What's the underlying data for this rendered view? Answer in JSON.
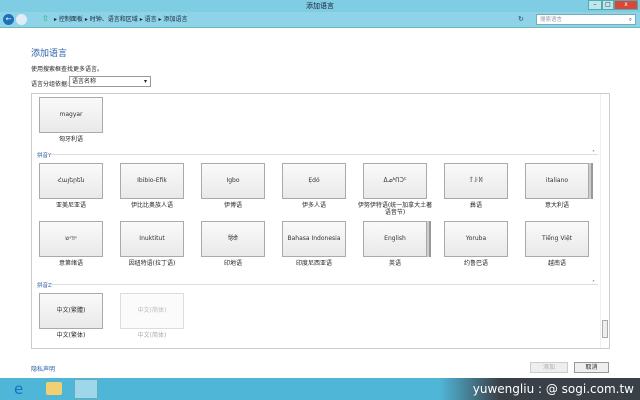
{
  "window": {
    "title": "添加语言",
    "min": "–",
    "max": "□",
    "close": "x"
  },
  "address": {
    "breadcrumb": [
      "控制面板",
      "时钟、语言和区域",
      "语言",
      "添加语言"
    ],
    "search_placeholder": "搜索语言"
  },
  "main": {
    "heading": "添加语言",
    "hint": "使用搜索框查找更多语言。",
    "group_label": "语言分组依据:",
    "group_value": "语言名称"
  },
  "top_tile": {
    "native": "magyar",
    "label": "匈牙利语"
  },
  "groups": [
    {
      "header": "拼音Y",
      "tiles": [
        {
          "native": "Հայերեն",
          "label": "亚美尼亚语"
        },
        {
          "native": "Ibibio-Efik",
          "label": "伊比比奥族人语"
        },
        {
          "native": "Igbo",
          "label": "伊博语"
        },
        {
          "native": "Ẹdó",
          "label": "伊多人语"
        },
        {
          "native": "ᐃᓄᒃᑎᑐᑦ",
          "label": "伊努伊特语(统一加拿大土著语音节)"
        },
        {
          "native": "ꆈꌠꉙ",
          "label": "彝语"
        },
        {
          "native": "italiano",
          "label": "意大利语",
          "stack": true
        },
        {
          "native": "ייִדיש",
          "label": "意第绪语"
        },
        {
          "native": "Inuktitut",
          "label": "因纽特语(拉丁语)"
        },
        {
          "native": "हिंदी",
          "label": "印地语"
        },
        {
          "native": "Bahasa Indonesia",
          "label": "印度尼西亚语"
        },
        {
          "native": "English",
          "label": "英语",
          "stack": true
        },
        {
          "native": "Yoruba",
          "label": "约鲁巴语"
        },
        {
          "native": "Tiếng Việt",
          "label": "越南语"
        }
      ]
    },
    {
      "header": "拼音Z",
      "tiles": [
        {
          "native": "中文(繁體)",
          "label": "中文(繁体)"
        },
        {
          "native": "中文(简体)",
          "label": "中文(简体)",
          "disabled": true
        }
      ]
    }
  ],
  "footer": {
    "privacy": "隐私声明",
    "add": "添加",
    "cancel": "取消"
  },
  "watermark": "yuwengliu : @ sogi.com.tw"
}
